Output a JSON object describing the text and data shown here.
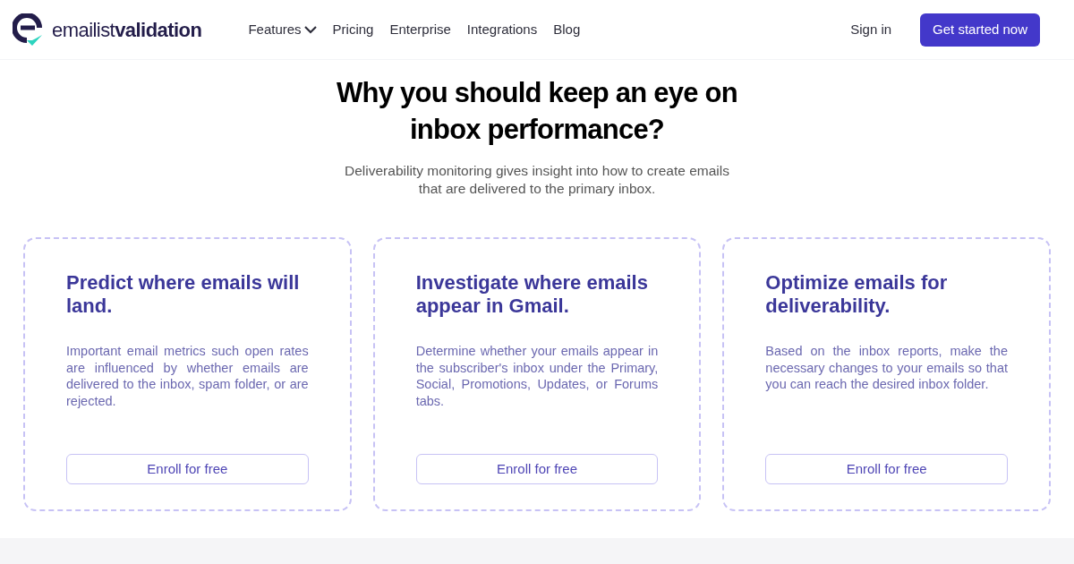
{
  "brand": {
    "name": "emailist**validation**"
  },
  "nav": [
    {
      "label": "Features",
      "kind": "dropdown"
    },
    {
      "label": "Pricing",
      "kind": "link"
    },
    {
      "label": "Enterprise",
      "kind": "link"
    },
    {
      "label": "Integrations",
      "kind": "link"
    },
    {
      "label": "Blog",
      "kind": "link"
    }
  ],
  "sign_in": "Sign in",
  "cta": "Get started now",
  "heading": "Why you should keep an eye on inbox performance?",
  "subheading": "Deliverability monitoring gives insight into how to create emails that are delivered to the primary inbox.",
  "cards": [
    {
      "title": "Predict where emails will land.",
      "text": "Important email metrics such open rates are influenced by whether emails are delivered to the inbox, spam folder, or are rejected.",
      "button": "Enroll for free"
    },
    {
      "title": "Investigate where emails appear in Gmail.",
      "text": "Determine whether your emails appear in the subscriber's inbox under the Primary, Social, Promotions, Updates, or Forums tabs.",
      "button": "Enroll for free"
    },
    {
      "title": "Optimize emails for deliverability.",
      "text": "Based on the inbox reports, make the necessary changes to your emails so that you can reach the desired inbox folder.",
      "button": "Enroll for free"
    }
  ]
}
